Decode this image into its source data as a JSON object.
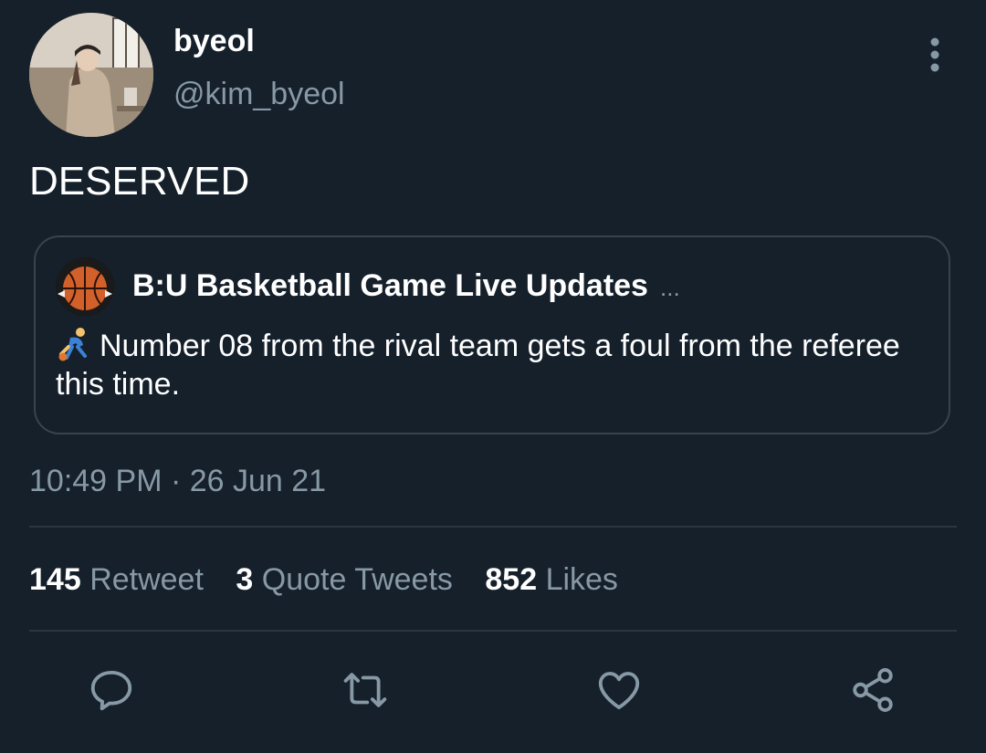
{
  "author": {
    "display_name": "byeol",
    "handle": "@kim_byeol"
  },
  "tweet": {
    "text": "DESERVED",
    "timestamp": "10:49 PM · 26 Jun 21"
  },
  "quoted_tweet": {
    "display_name": "B:U Basketball Game Live Updates",
    "ellipsis": "...",
    "emoji": "person-bouncing-ball-emoji",
    "text": "Number 08 from the rival team gets a foul from the referee this time."
  },
  "stats": {
    "retweets": {
      "count": "145",
      "label": "Retweet"
    },
    "quotes": {
      "count": "3",
      "label": "Quote Tweets"
    },
    "likes": {
      "count": "852",
      "label": "Likes"
    }
  },
  "icons": {
    "more": "more-vertical-icon",
    "reply": "reply-icon",
    "retweet": "retweet-icon",
    "like": "heart-icon",
    "share": "share-icon"
  },
  "colors": {
    "background": "#15202b",
    "secondary_text": "#8899a6",
    "border": "#38444d"
  }
}
